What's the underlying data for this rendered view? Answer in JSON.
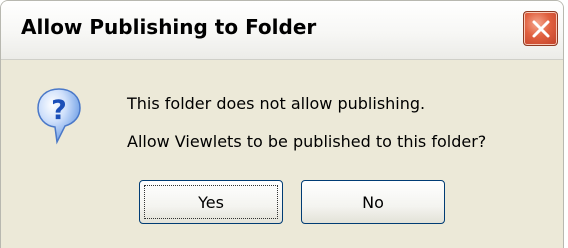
{
  "dialog": {
    "title": "Allow Publishing to Folder",
    "message_line1": "This folder does not allow publishing.",
    "message_line2": "Allow Viewlets to be published to this folder?",
    "yes_label": "Yes",
    "no_label": "No",
    "icon": "question-icon",
    "close_icon": "close-icon"
  },
  "colors": {
    "dialog_bg": "#ece9d8",
    "close_button": "#e0603f",
    "button_border": "#003c74",
    "icon_blue": "#2b6fd6"
  }
}
